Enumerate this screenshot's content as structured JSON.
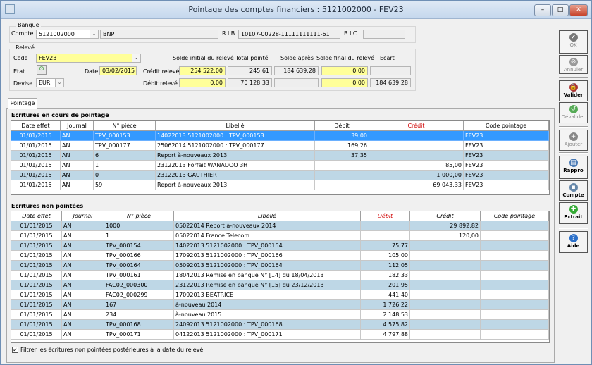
{
  "window": {
    "title": "Pointage des comptes financiers : 5121002000 - FEV23",
    "min": "–",
    "max": "□",
    "close": "✕"
  },
  "banque": {
    "group": "Banque",
    "compte_label": "Compte",
    "compte": "5121002000",
    "nom": "BNP",
    "rib_label": "R.I.B.",
    "rib": "10107-00228-11111111111-61",
    "bic_label": "B.I.C.",
    "bic": ""
  },
  "releve": {
    "group": "Relevé",
    "code_label": "Code",
    "code": "FEV23",
    "etat_label": "Etat",
    "date_label": "Date",
    "date": "03/02/2015",
    "devise_label": "Devise",
    "devise": "EUR",
    "cols": {
      "solde_initial": "Solde initial du relevé",
      "total_pointe": "Total pointé",
      "solde_apres": "Solde après",
      "solde_final": "Solde final du relevé",
      "ecart": "Ecart"
    },
    "credit_label": "Crédit relevé",
    "debit_label": "Débit relevé",
    "credit": {
      "solde_initial": "254 522,00",
      "total_pointe": "245,61",
      "solde_apres": "184 639,28",
      "solde_final": "0,00",
      "ecart": ""
    },
    "debit": {
      "solde_initial": "0,00",
      "total_pointe": "70 128,33",
      "solde_apres": "",
      "solde_final": "0,00",
      "ecart": "184 639,28"
    }
  },
  "toolbar": [
    {
      "label": "OK",
      "icon": "check-icon",
      "enabled": false
    },
    {
      "label": "Annuler",
      "icon": "cancel-icon",
      "enabled": false
    },
    {
      "label": "Valider",
      "icon": "lock-icon",
      "enabled": true
    },
    {
      "label": "Dévalider",
      "icon": "unlock-icon",
      "enabled": false
    },
    {
      "label": "Ajouter",
      "icon": "plus-icon",
      "enabled": false
    },
    {
      "label": "Rappro",
      "icon": "printer-icon",
      "enabled": true
    },
    {
      "label": "Compte",
      "icon": "calculator-icon",
      "enabled": true
    },
    {
      "label": "Extrait",
      "icon": "extract-icon",
      "enabled": true
    },
    {
      "label": "Aide",
      "icon": "help-icon",
      "enabled": true
    }
  ],
  "tab": "Pointage",
  "pointage": {
    "title": "Ecritures en cours de pointage",
    "headers": [
      "Date effet",
      "Journal",
      "N° pièce",
      "Libellé",
      "Débit",
      "Crédit",
      "Code pointage"
    ],
    "rows": [
      [
        "01/01/2015",
        "AN",
        "TPV_000153",
        "14022013 5121002000 : TPV_000153",
        "39,00",
        "",
        "FEV23"
      ],
      [
        "01/01/2015",
        "AN",
        "TPV_000177",
        "25062014 5121002000 : TPV_000177",
        "169,26",
        "",
        "FEV23"
      ],
      [
        "01/01/2015",
        "AN",
        "6",
        "Report à-nouveaux 2013",
        "37,35",
        "",
        "FEV23"
      ],
      [
        "01/01/2015",
        "AN",
        "1",
        "23122013 Forfait WANADOO 3H",
        "",
        "85,00",
        "FEV23"
      ],
      [
        "01/01/2015",
        "AN",
        "0",
        "23122013 GAUTHIER",
        "",
        "1 000,00",
        "FEV23"
      ],
      [
        "01/01/2015",
        "AN",
        "59",
        "Report à-nouveaux 2013",
        "",
        "69 043,33",
        "FEV23"
      ]
    ]
  },
  "non_pointees": {
    "title": "Ecritures non pointées",
    "headers": [
      "Date effet",
      "Journal",
      "N° pièce",
      "Libellé",
      "Débit",
      "Crédit",
      "Code pointage"
    ],
    "rows": [
      [
        "01/01/2015",
        "AN",
        "1000",
        "05022014 Report à-nouveaux 2014",
        "",
        "29 892,82",
        ""
      ],
      [
        "01/01/2015",
        "AN",
        "1",
        "05022014 France Telecom",
        "",
        "120,00",
        ""
      ],
      [
        "01/01/2015",
        "AN",
        "TPV_000154",
        "14022013 5121002000 : TPV_000154",
        "75,77",
        "",
        ""
      ],
      [
        "01/01/2015",
        "AN",
        "TPV_000166",
        "17092013 5121002000 : TPV_000166",
        "105,00",
        "",
        ""
      ],
      [
        "01/01/2015",
        "AN",
        "TPV_000164",
        "05092013 5121002000 : TPV_000164",
        "112,05",
        "",
        ""
      ],
      [
        "01/01/2015",
        "AN",
        "TPV_000161",
        "18042013 Remise en banque N° [14] du 18/04/2013",
        "182,33",
        "",
        ""
      ],
      [
        "01/01/2015",
        "AN",
        "FAC02_000300",
        "23122013 Remise en banque N° [15] du 23/12/2013",
        "201,95",
        "",
        ""
      ],
      [
        "01/01/2015",
        "AN",
        "FAC02_000299",
        "17092013 BEATRICE",
        "441,40",
        "",
        ""
      ],
      [
        "01/01/2015",
        "AN",
        "167",
        "à-nouveau 2014",
        "1 726,22",
        "",
        ""
      ],
      [
        "01/01/2015",
        "AN",
        "234",
        "à-nouveau 2015",
        "2 148,53",
        "",
        ""
      ],
      [
        "01/01/2015",
        "AN",
        "TPV_000168",
        "24092013 5121002000 : TPV_000168",
        "4 575,82",
        "",
        ""
      ],
      [
        "01/01/2015",
        "AN",
        "TPV_000171",
        "04122013 5121002000 : TPV_000171",
        "4 797,88",
        "",
        ""
      ]
    ]
  },
  "filter": {
    "label": "Filtrer les écritures non pointées postérieures à la date du relevé",
    "checked": true
  }
}
